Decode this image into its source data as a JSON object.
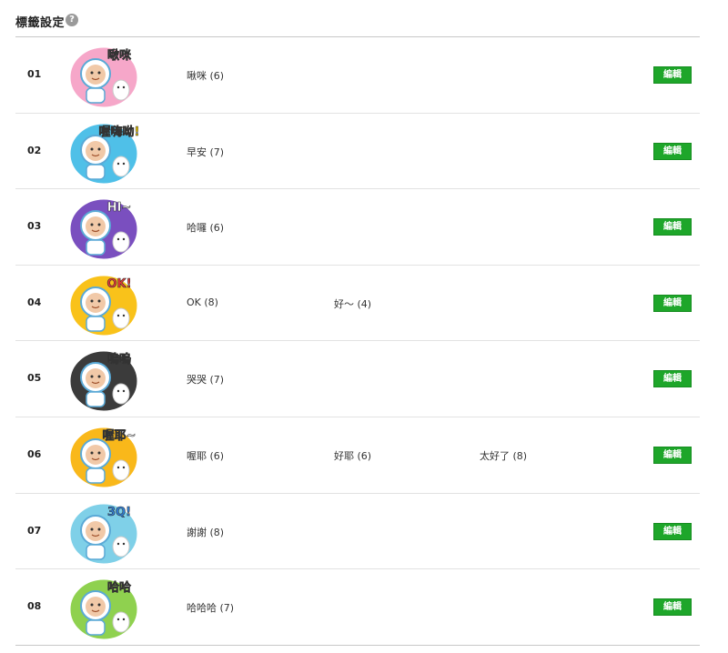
{
  "header": {
    "title": "標籤設定",
    "help_glyph": "?"
  },
  "edit_label": "編輯",
  "rows": [
    {
      "num": "01",
      "tags": [
        "啾咪 (6)"
      ],
      "sticker": {
        "text": "啾咪",
        "bg": "#f6a7c9",
        "accent": "#f472b6"
      }
    },
    {
      "num": "02",
      "tags": [
        "早安 (7)"
      ],
      "sticker": {
        "text": "喔嗨呦!",
        "bg": "#4fc0e8",
        "accent": "#f5d000"
      }
    },
    {
      "num": "03",
      "tags": [
        "哈囉 (6)"
      ],
      "sticker": {
        "text": "HI~",
        "bg": "#7a4fbf",
        "accent": "#ffffff"
      }
    },
    {
      "num": "04",
      "tags": [
        "OK (8)",
        "好～ (4)"
      ],
      "sticker": {
        "text": "OK!",
        "bg": "#f9c21a",
        "accent": "#e53935"
      }
    },
    {
      "num": "05",
      "tags": [
        "哭哭 (7)"
      ],
      "sticker": {
        "text": "嗚嗚",
        "bg": "#3b3b3b",
        "accent": "#ffffff"
      }
    },
    {
      "num": "06",
      "tags": [
        "喔耶 (6)",
        "好耶 (6)",
        "太好了 (8)"
      ],
      "sticker": {
        "text": "喔耶~",
        "bg": "#f9b81a",
        "accent": "#ffffff"
      }
    },
    {
      "num": "07",
      "tags": [
        "謝謝 (8)"
      ],
      "sticker": {
        "text": "3Q!",
        "bg": "#7fd0e8",
        "accent": "#2f7fd8"
      }
    },
    {
      "num": "08",
      "tags": [
        "哈哈哈 (7)"
      ],
      "sticker": {
        "text": "哈哈",
        "bg": "#8fd14f",
        "accent": "#f97316"
      }
    }
  ]
}
